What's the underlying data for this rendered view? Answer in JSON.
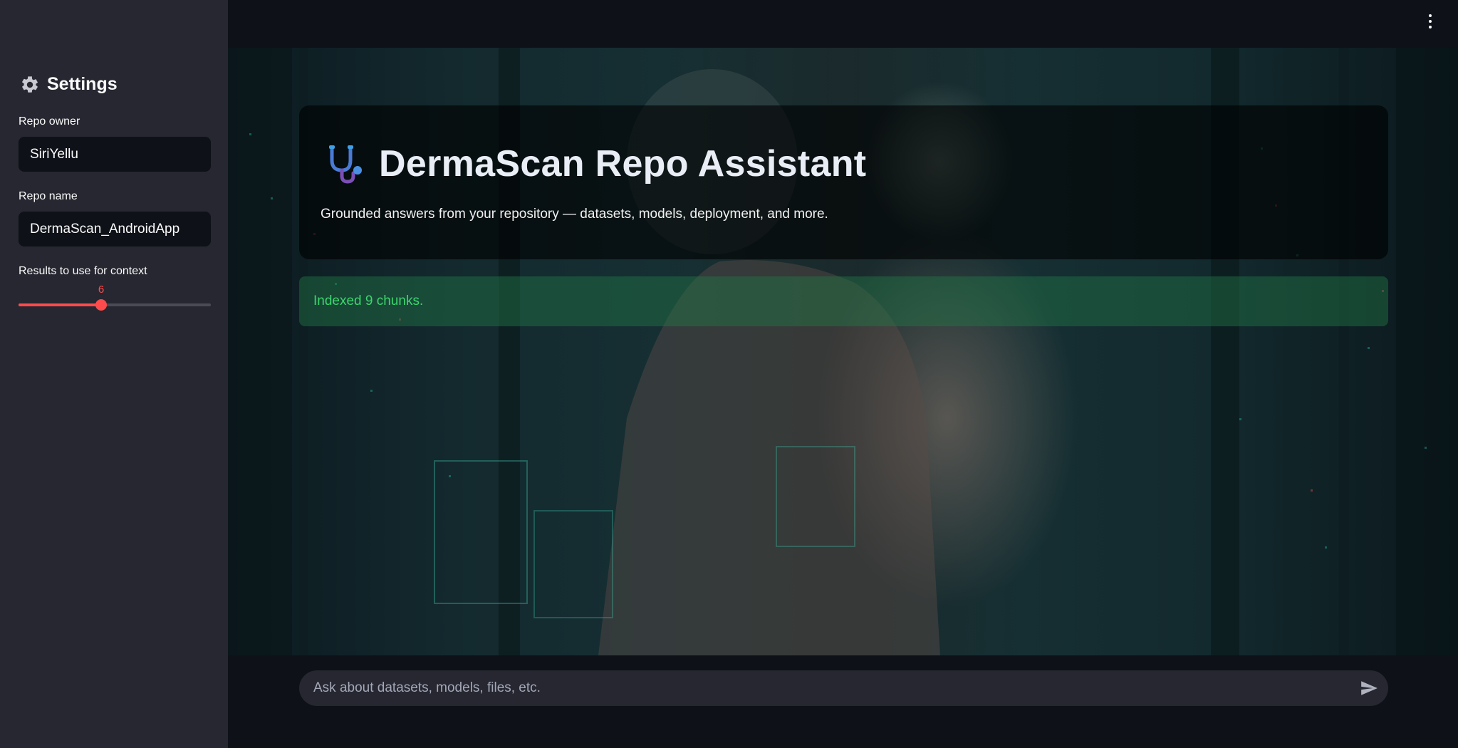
{
  "sidebar": {
    "title": "Settings",
    "header_icon": "gear-icon",
    "repo_owner": {
      "label": "Repo owner",
      "value": "SiriYellu"
    },
    "repo_name": {
      "label": "Repo name",
      "value": "DermaScan_AndroidApp"
    },
    "results": {
      "label": "Results to use for context",
      "value": "6",
      "fraction": 0.43
    }
  },
  "header": {
    "icon": "stethoscope-icon",
    "title": "DermaScan Repo Assistant",
    "subtitle": "Grounded answers from your repository — datasets, models, deployment, and more."
  },
  "status": {
    "message": "Indexed 9 chunks.",
    "color": "#3dd56d"
  },
  "chat": {
    "placeholder": "Ask about datasets, models, files, etc.",
    "send_icon": "send-icon"
  },
  "colors": {
    "accent": "#ff4b4b",
    "sidebar_bg": "#262730",
    "main_bg": "#0e1117"
  }
}
